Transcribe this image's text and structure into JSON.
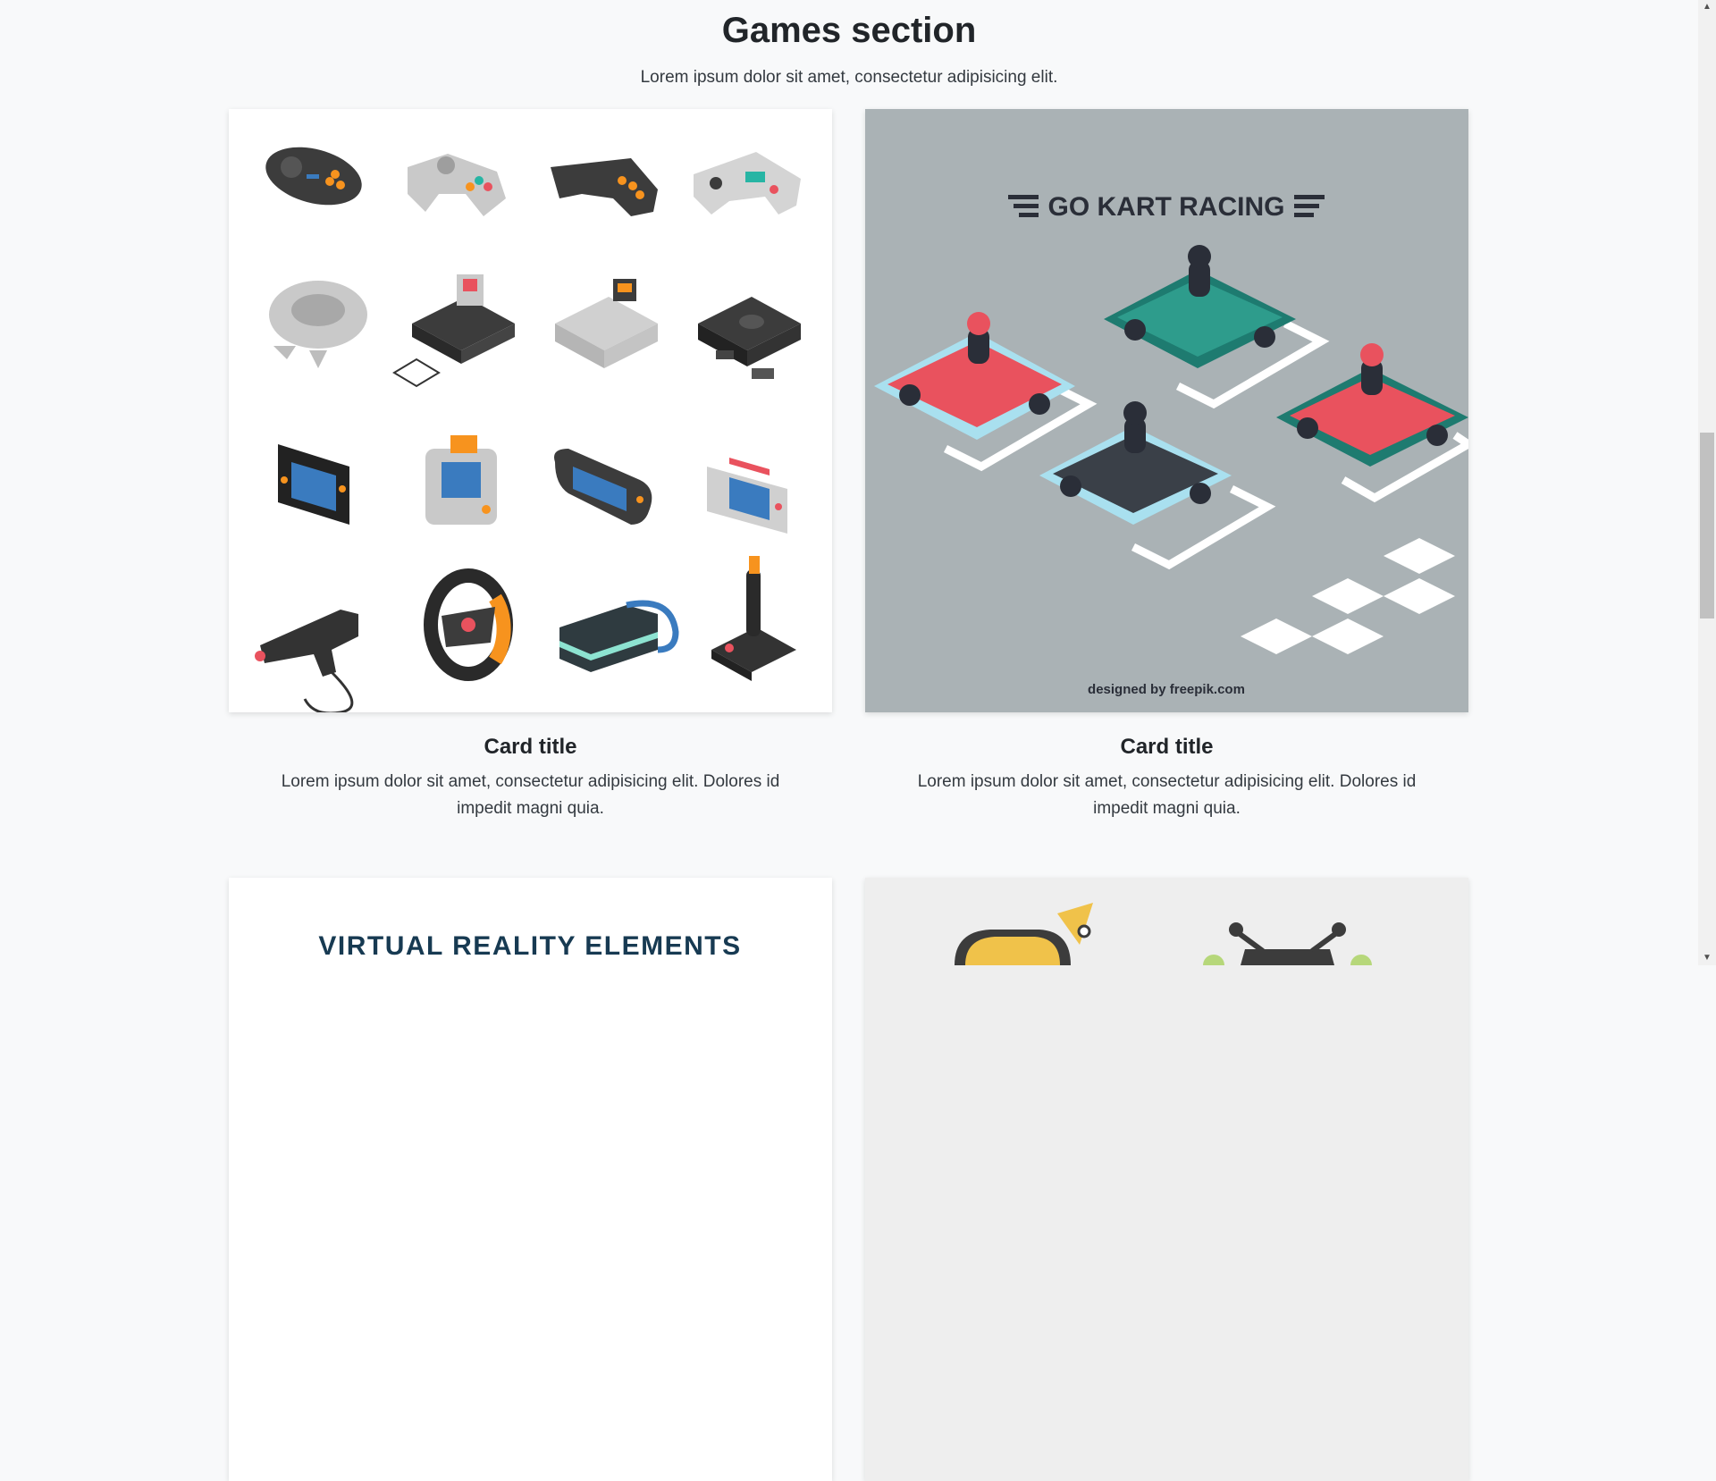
{
  "section": {
    "title": "Games section",
    "subtitle": "Lorem ipsum dolor sit amet, consectetur adipisicing elit."
  },
  "cards": [
    {
      "title": "Card title",
      "text": "Lorem ipsum dolor sit amet, consectetur adipisicing elit. Dolores id impedit magni quia.",
      "image_bg": "#ffffff"
    },
    {
      "title": "Card title",
      "text": "Lorem ipsum dolor sit amet, consectetur adipisicing elit. Dolores id impedit magni quia.",
      "image_bg": "#aab2b5",
      "image_heading": "GO KART RACING",
      "image_credit": "designed by freepik.com"
    }
  ],
  "cards_row2": [
    {
      "image_heading": "VIRTUAL REALITY ELEMENTS",
      "image_bg": "#ffffff"
    },
    {
      "image_bg": "#eeeeee"
    }
  ],
  "colors": {
    "page_bg": "#f8f9fa",
    "kart_red": "#e9525e",
    "kart_teal": "#1e7b70",
    "kart_light": "#a9e0ef",
    "controller_dark": "#3c3c3c",
    "accent_orange": "#f7931e",
    "screen_blue": "#3a7bbf",
    "vr_text": "#173a52"
  },
  "icons": [
    "scroll-up-arrow-icon",
    "scroll-down-arrow-icon",
    "freepik-logo-icon"
  ]
}
